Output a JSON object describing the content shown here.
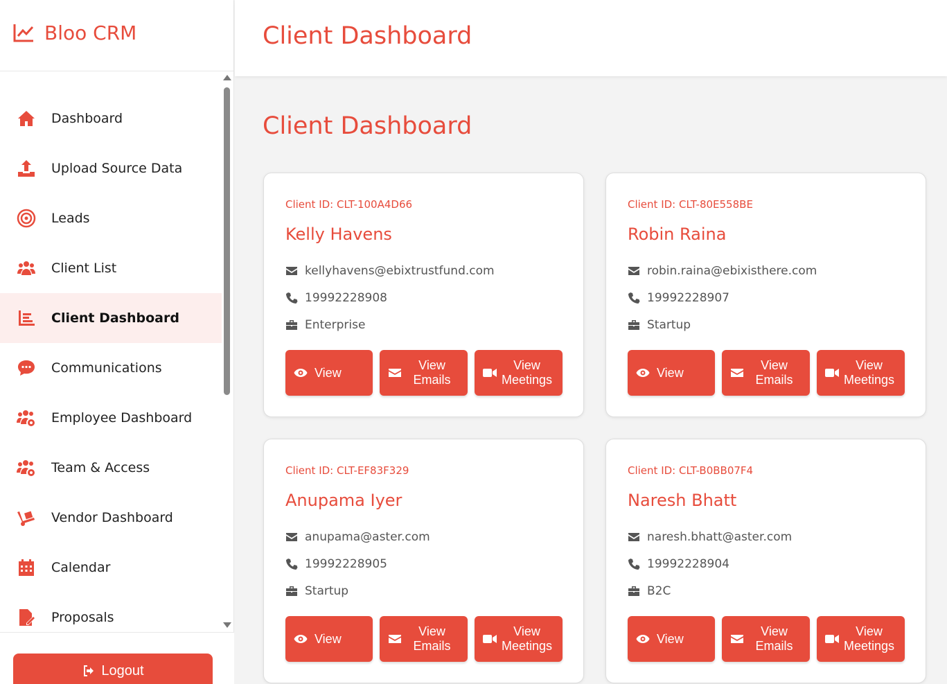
{
  "brand": {
    "name": "Bloo CRM"
  },
  "header": {
    "title": "Client Dashboard"
  },
  "main": {
    "title": "Client Dashboard"
  },
  "accent_color": "#e74c3c",
  "sidebar": {
    "items": [
      {
        "label": "Dashboard",
        "icon": "home-icon"
      },
      {
        "label": "Upload Source Data",
        "icon": "upload-icon"
      },
      {
        "label": "Leads",
        "icon": "target-icon"
      },
      {
        "label": "Client List",
        "icon": "users-icon"
      },
      {
        "label": "Client Dashboard",
        "icon": "chart-icon",
        "active": true
      },
      {
        "label": "Communications",
        "icon": "chat-icon"
      },
      {
        "label": "Employee Dashboard",
        "icon": "users-gear-icon"
      },
      {
        "label": "Team & Access",
        "icon": "users-gear-icon"
      },
      {
        "label": "Vendor Dashboard",
        "icon": "dolly-icon"
      },
      {
        "label": "Calendar",
        "icon": "calendar-icon"
      },
      {
        "label": "Proposals",
        "icon": "file-edit-icon"
      }
    ],
    "logout_label": "Logout"
  },
  "buttons": {
    "view": "View",
    "view_emails_1": "View",
    "view_emails_2": "Emails",
    "view_meetings_1": "View",
    "view_meetings_2": "Meetings"
  },
  "clients": [
    {
      "id_label": "Client ID: CLT-100A4D66",
      "name": "Kelly Havens",
      "email": "kellyhavens@ebixtrustfund.com",
      "phone": "19992228908",
      "type": "Enterprise"
    },
    {
      "id_label": "Client ID: CLT-80E558BE",
      "name": "Robin Raina",
      "email": "robin.raina@ebixisthere.com",
      "phone": "19992228907",
      "type": "Startup"
    },
    {
      "id_label": "Client ID: CLT-EF83F329",
      "name": "Anupama Iyer",
      "email": "anupama@aster.com",
      "phone": "19992228905",
      "type": "Startup"
    },
    {
      "id_label": "Client ID: CLT-B0BB07F4",
      "name": "Naresh Bhatt",
      "email": "naresh.bhatt@aster.com",
      "phone": "19992228904",
      "type": "B2C"
    }
  ]
}
